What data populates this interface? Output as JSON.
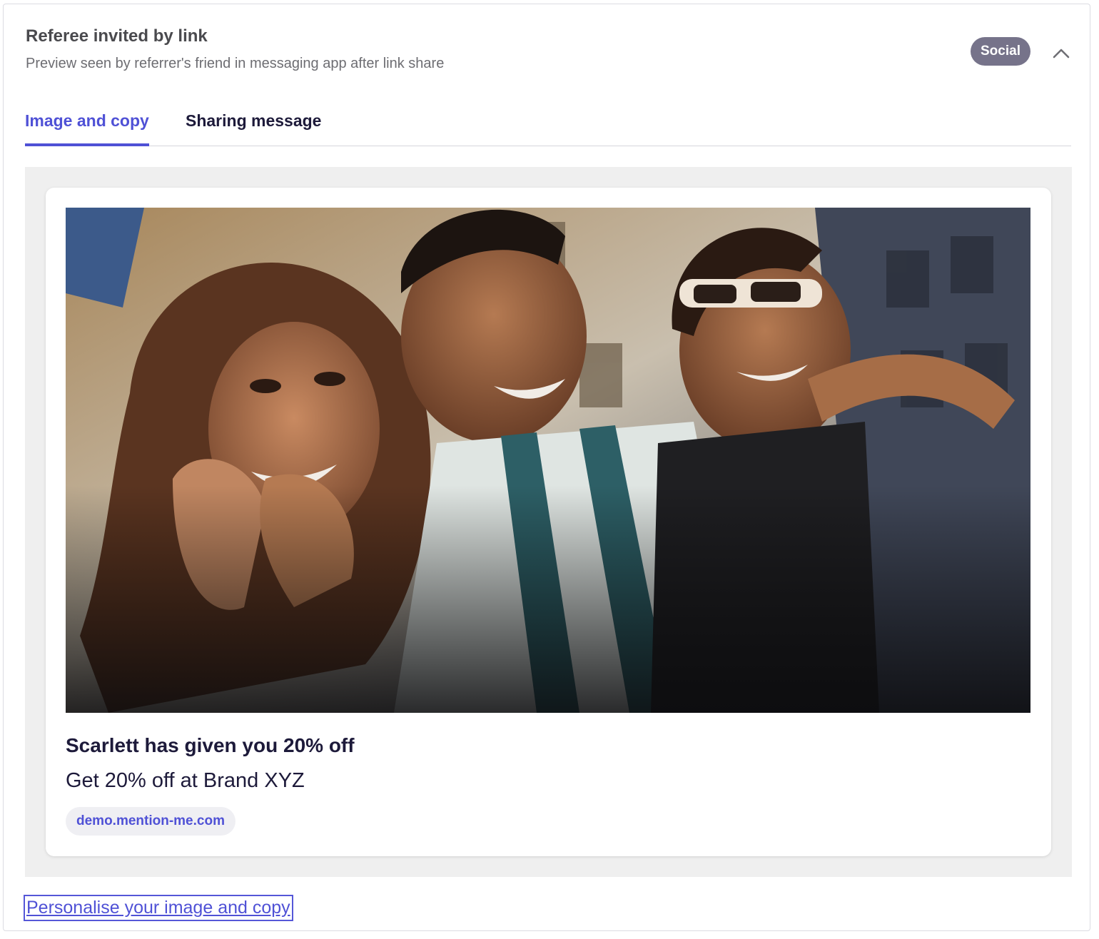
{
  "header": {
    "title": "Referee invited by link",
    "subtitle": "Preview seen by referrer's friend in messaging app after link share",
    "badge": "Social",
    "collapse_icon": "chevron-up-icon"
  },
  "tabs": [
    {
      "label": "Image and copy",
      "active": true
    },
    {
      "label": "Sharing message",
      "active": false
    }
  ],
  "preview": {
    "image_description_icon": "photo-image",
    "headline": "Scarlett has given you 20% off",
    "body": "Get 20% off at Brand XYZ",
    "url": "demo.mention-me.com"
  },
  "footer": {
    "link": "Personalise your image and copy"
  },
  "colors": {
    "accent": "#4f51d6",
    "badge_bg": "#76738a",
    "preview_bg": "#efefef"
  }
}
